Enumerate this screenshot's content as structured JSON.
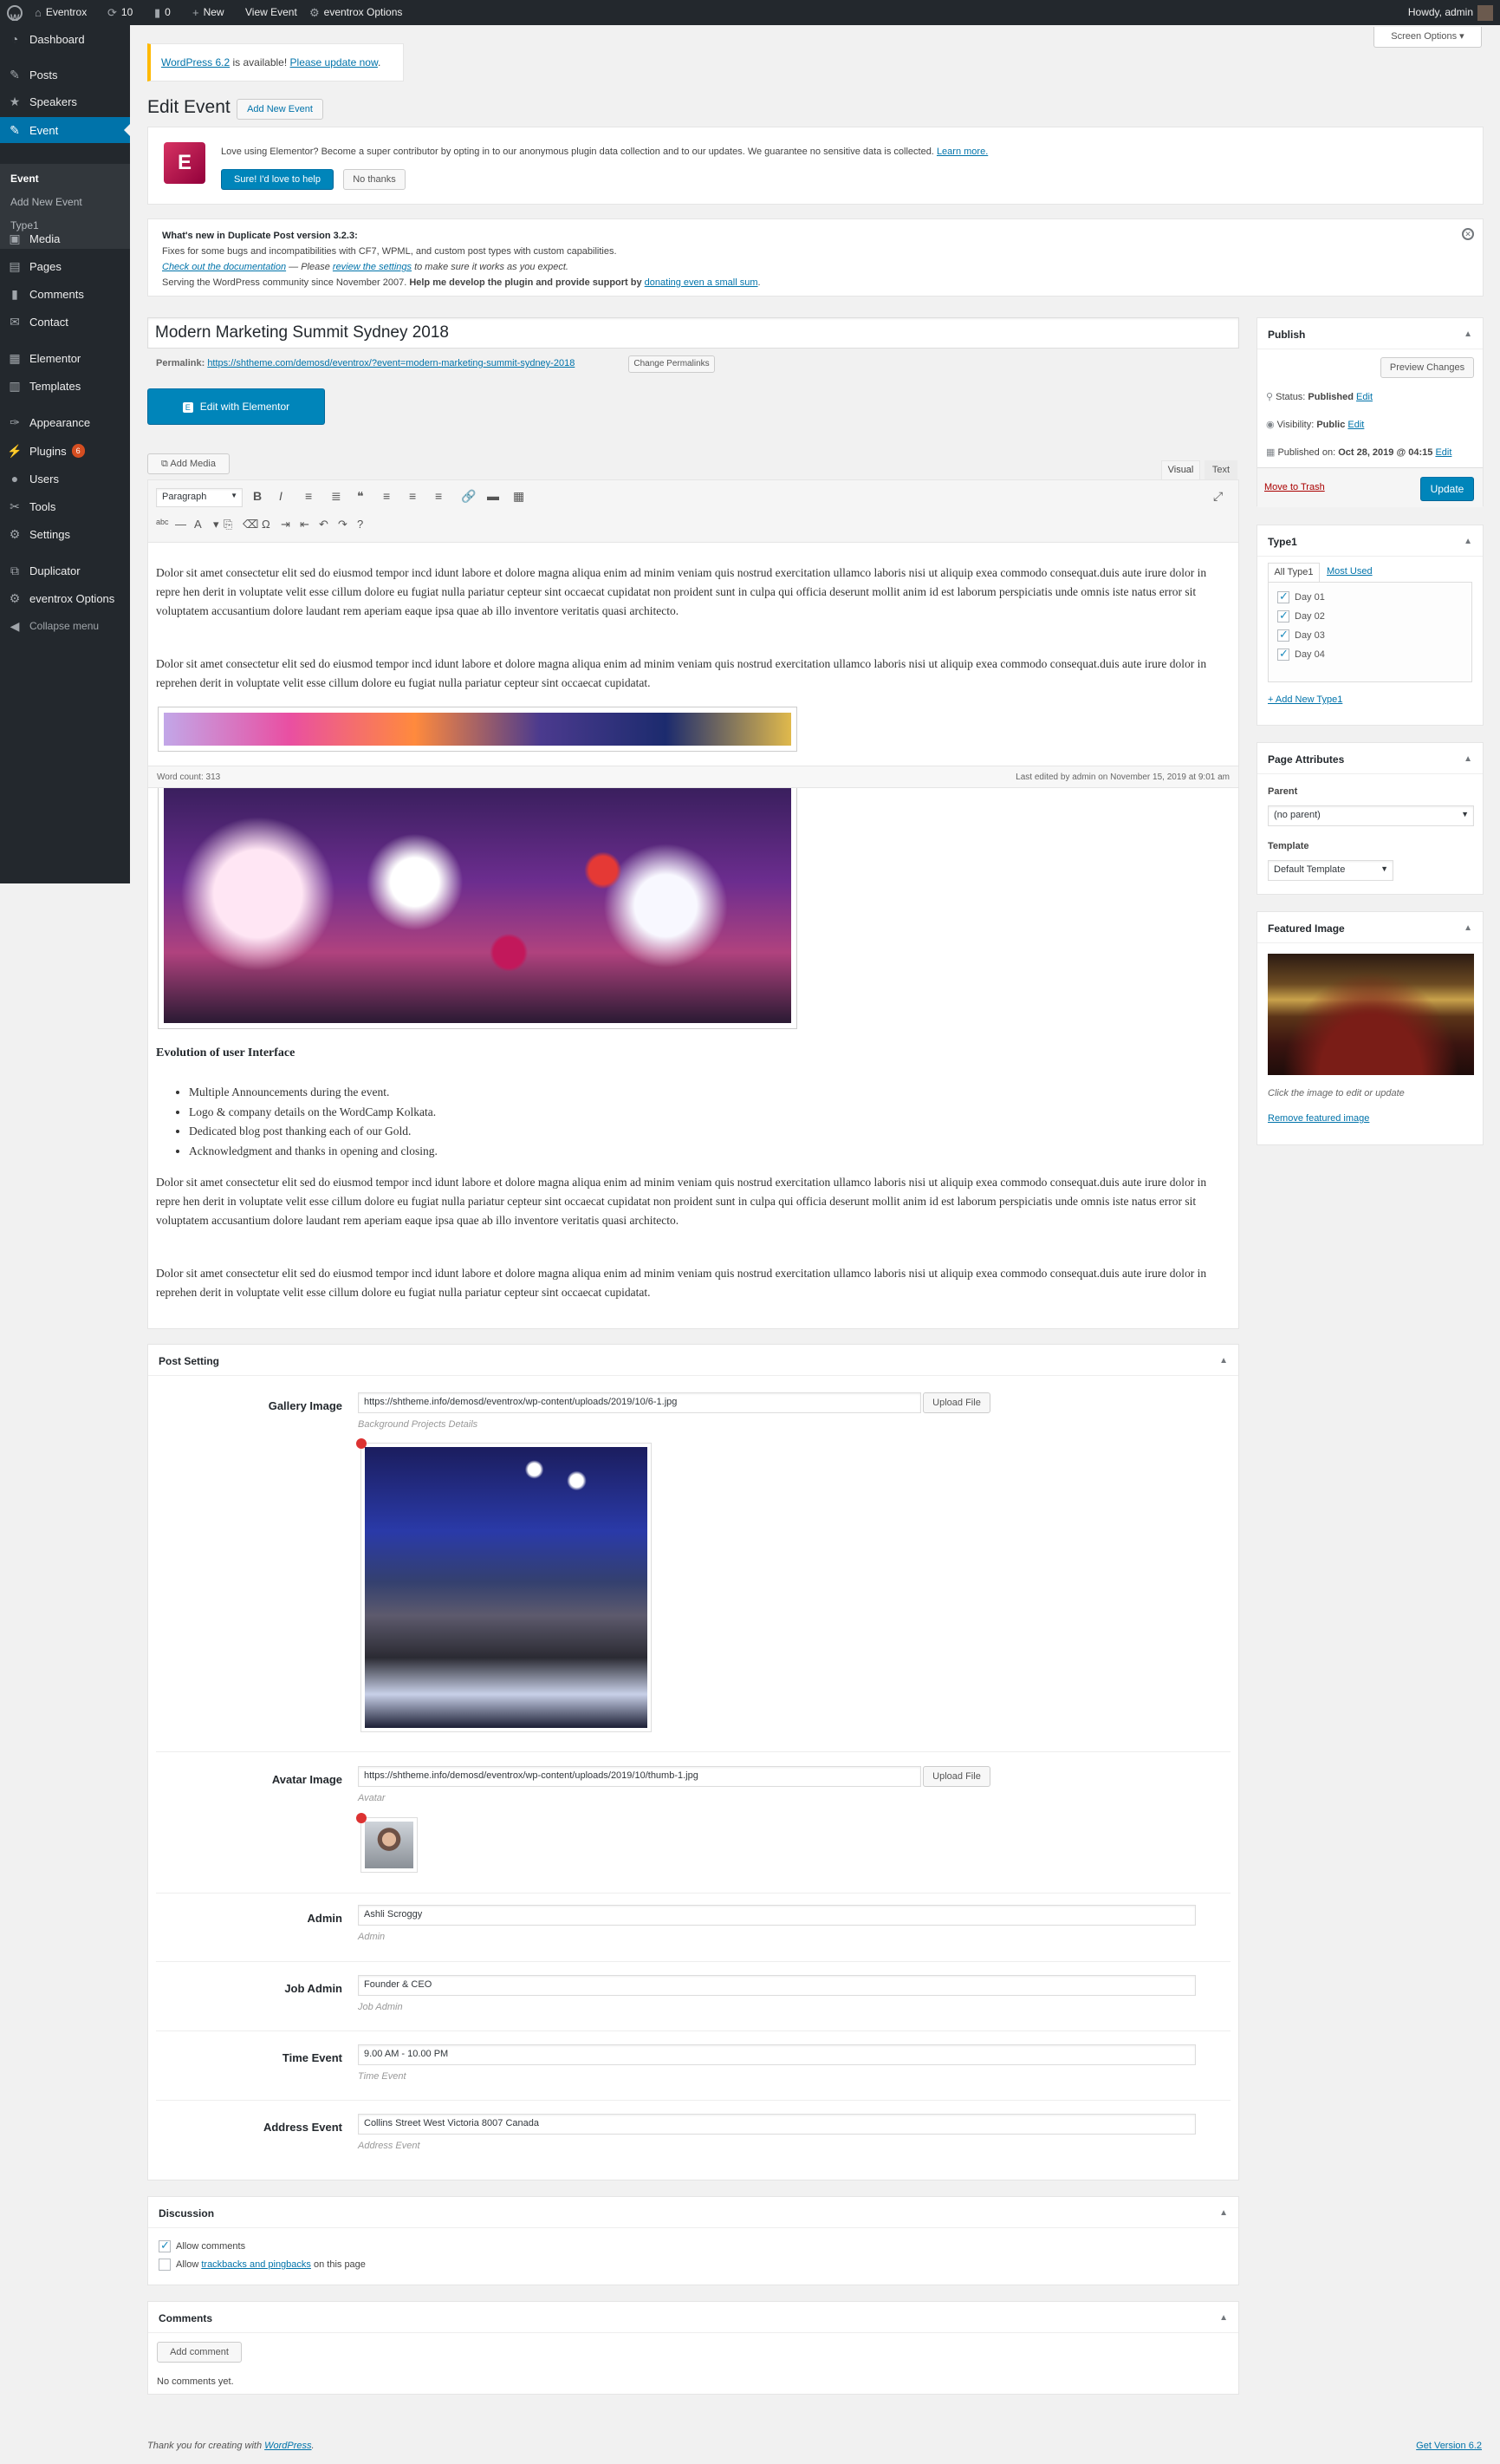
{
  "admin_bar": {
    "site": "Eventrox",
    "updates": "10",
    "comments": "0",
    "new": "New",
    "view": "View Event",
    "options": "eventrox Options",
    "howdy": "Howdy, admin"
  },
  "screen_options": "Screen Options",
  "menu": {
    "items": [
      {
        "label": "Dashboard",
        "icon": "dashboard-icon",
        "glyph": "◔"
      },
      {
        "label": "Posts",
        "icon": "pin-icon",
        "glyph": "✎"
      },
      {
        "label": "Speakers",
        "icon": "star-icon",
        "glyph": "★"
      },
      {
        "label": "Event",
        "icon": "pin-icon",
        "glyph": "✎"
      },
      {
        "label": "Media",
        "icon": "media-icon",
        "glyph": "▣"
      },
      {
        "label": "Pages",
        "icon": "page-icon",
        "glyph": "▤"
      },
      {
        "label": "Comments",
        "icon": "comment-icon",
        "glyph": "▮"
      },
      {
        "label": "Contact",
        "icon": "mail-icon",
        "glyph": "✉"
      },
      {
        "label": "Elementor",
        "icon": "elementor-icon",
        "glyph": "▦"
      },
      {
        "label": "Templates",
        "icon": "folder-icon",
        "glyph": "▥"
      },
      {
        "label": "Appearance",
        "icon": "brush-icon",
        "glyph": "✑"
      },
      {
        "label": "Plugins",
        "icon": "plug-icon",
        "glyph": "⚡",
        "badge": "6"
      },
      {
        "label": "Users",
        "icon": "user-icon",
        "glyph": "●"
      },
      {
        "label": "Tools",
        "icon": "wrench-icon",
        "glyph": "✂"
      },
      {
        "label": "Settings",
        "icon": "settings-icon",
        "glyph": "⚙"
      },
      {
        "label": "Duplicator",
        "icon": "duplicator-icon",
        "glyph": "⧉"
      },
      {
        "label": "eventrox Options",
        "icon": "gear-icon",
        "glyph": "⚙"
      },
      {
        "label": "Collapse menu",
        "icon": "collapse-icon",
        "glyph": "◀"
      }
    ],
    "submenu": [
      "Event",
      "Add New Event",
      "Type1"
    ]
  },
  "notice": {
    "version": "WordPress 6.2",
    "text": " is available! ",
    "link": "Please update now",
    "end": "."
  },
  "page_title": "Edit Event",
  "add_new": "Add New Event",
  "elementor_notice": {
    "text": "Love using Elementor? Become a super contributor by opting in to our anonymous plugin data collection and to our updates. We guarantee no sensitive data is collected.",
    "learn": "Learn more.",
    "yes": "Sure! I'd love to help",
    "no": "No thanks"
  },
  "dup": {
    "title": "What's new in Duplicate Post version 3.2.3:",
    "l1": "Fixes for some bugs and incompatibilities with CF7, WPML, and custom post types with custom capabilities.",
    "l2a": "Check out the documentation",
    "l2b": " — Please ",
    "l2c": "review the settings",
    "l2d": " to make sure it works as you expect.",
    "l3a": "Serving the WordPress community since November 2007. ",
    "l3b": "Help me develop the plugin and provide support by ",
    "l3c": "donating even a small sum",
    "l3d": "."
  },
  "post_title": "Modern Marketing Summit Sydney 2018",
  "permalink": {
    "label": "Permalink:",
    "url": "https://shtheme.com/demosd/eventrox/?event=modern-marketing-summit-sydney-2018",
    "btn": "Change Permalinks"
  },
  "elementor_btn": "Edit with Elementor",
  "editor": {
    "add_media": "Add Media",
    "visual": "Visual",
    "text": "Text",
    "format": "Paragraph",
    "word_count": "Word count: 313",
    "last_edited": "Last edited by admin on November 15, 2019 at 9:01 am"
  },
  "content": {
    "p1": "Dolor sit amet consectetur elit sed do eiusmod tempor incd idunt labore et dolore magna aliqua enim ad minim veniam quis nostrud exercitation ullamco laboris nisi ut aliquip exea commodo consequat.duis aute irure dolor in repre hen derit in voluptate velit esse cillum dolore eu fugiat nulla pariatur cepteur sint occaecat cupidatat non proident sunt in culpa qui officia deserunt mollit anim id est laborum perspiciatis unde omnis iste natus error sit voluptatem accusantium dolore laudant rem aperiam eaque ipsa quae ab illo inventore veritatis quasi architecto.",
    "p2": "Dolor sit amet consectetur elit sed do eiusmod tempor incd idunt labore et dolore magna aliqua enim ad minim veniam quis nostrud exercitation ullamco laboris nisi ut aliquip exea commodo consequat.duis aute irure dolor in reprehen derit in voluptate velit esse cillum dolore eu fugiat nulla pariatur cepteur sint occaecat cupidatat.",
    "heading": "Evolution of user Interface",
    "bullets": [
      "Multiple Announcements during the event.",
      "Logo & company details on the WordCamp Kolkata.",
      "Dedicated blog post thanking each of our Gold.",
      "Acknowledgment and thanks in opening and closing."
    ],
    "p3": "Dolor sit amet consectetur elit sed do eiusmod tempor incd idunt labore et dolore magna aliqua enim ad minim veniam quis nostrud exercitation ullamco laboris nisi ut aliquip exea commodo consequat.duis aute irure dolor in repre hen derit in voluptate velit esse cillum dolore eu fugiat nulla pariatur cepteur sint occaecat cupidatat non proident sunt in culpa qui officia deserunt mollit anim id est laborum perspiciatis unde omnis iste natus error sit voluptatem accusantium dolore laudant rem aperiam eaque ipsa quae ab illo inventore veritatis quasi architecto.",
    "p4": "Dolor sit amet consectetur elit sed do eiusmod tempor incd idunt labore et dolore magna aliqua enim ad minim veniam quis nostrud exercitation ullamco laboris nisi ut aliquip exea commodo consequat.duis aute irure dolor in reprehen derit in voluptate velit esse cillum dolore eu fugiat nulla pariatur cepteur sint occaecat cupidatat."
  },
  "post_setting": {
    "title": "Post Setting",
    "upload": "Upload File",
    "gallery": {
      "label": "Gallery Image",
      "value": "https://shtheme.info/demosd/eventrox/wp-content/uploads/2019/10/6-1.jpg",
      "desc": "Background Projects Details"
    },
    "avatar": {
      "label": "Avatar Image",
      "value": "https://shtheme.info/demosd/eventrox/wp-content/uploads/2019/10/thumb-1.jpg",
      "desc": "Avatar"
    },
    "admin": {
      "label": "Admin",
      "value": "Ashli Scroggy",
      "desc": "Admin"
    },
    "job": {
      "label": "Job Admin",
      "value": "Founder & CEO",
      "desc": "Job Admin"
    },
    "time": {
      "label": "Time Event",
      "value": "9.00 AM - 10.00 PM",
      "desc": "Time Event"
    },
    "address": {
      "label": "Address Event",
      "value": "Collins Street West Victoria 8007 Canada",
      "desc": "Address Event"
    }
  },
  "discussion": {
    "title": "Discussion",
    "allow": "Allow comments",
    "allow2a": "Allow ",
    "allow2b": "trackbacks and pingbacks",
    "allow2c": " on this page"
  },
  "comments": {
    "title": "Comments",
    "add": "Add comment",
    "none": "No comments yet."
  },
  "publish": {
    "title": "Publish",
    "preview": "Preview Changes",
    "status_l": "Status: ",
    "status": "Published",
    "vis_l": "Visibility: ",
    "vis": "Public",
    "pub_l": "Published on: ",
    "pub": "Oct 28, 2019 @ 04:15",
    "edit": "Edit",
    "trash": "Move to Trash",
    "update": "Update"
  },
  "type1": {
    "title": "Type1",
    "tab_all": "All Type1",
    "tab_used": "Most Used",
    "items": [
      "Day 01",
      "Day 02",
      "Day 03",
      "Day 04"
    ],
    "add": "+ Add New Type1"
  },
  "attributes": {
    "title": "Page Attributes",
    "parent_l": "Parent",
    "parent": "(no parent)",
    "template_l": "Template",
    "template": "Default Template"
  },
  "featured": {
    "title": "Featured Image",
    "hint": "Click the image to edit or update",
    "remove": "Remove featured image"
  },
  "footer": {
    "thanks": "Thank you for creating with ",
    "wp": "WordPress",
    "end": ".",
    "version": "Get Version 6.2"
  }
}
